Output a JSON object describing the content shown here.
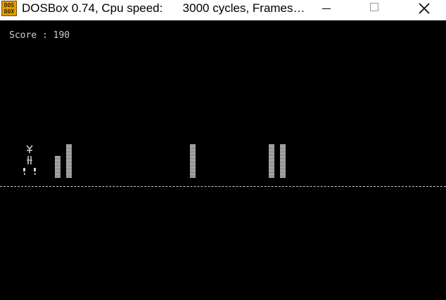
{
  "window": {
    "title": "DOSBox 0.74, Cpu speed:      3000 cycles, Frames…",
    "icon": "dosbox-icon",
    "icon_text_line1": "DOS",
    "icon_text_line2": "BOX",
    "controls": [
      "minimize-icon",
      "maximize-icon",
      "close-icon"
    ]
  },
  "game": {
    "score_label": "Score",
    "score_separator": " : ",
    "score_value": "190",
    "score_text": "Score : 190",
    "obstacles_count": 5,
    "colors": {
      "background": "#000000",
      "foreground": "#d0d0d0",
      "titlebar": "#ffffff"
    }
  }
}
